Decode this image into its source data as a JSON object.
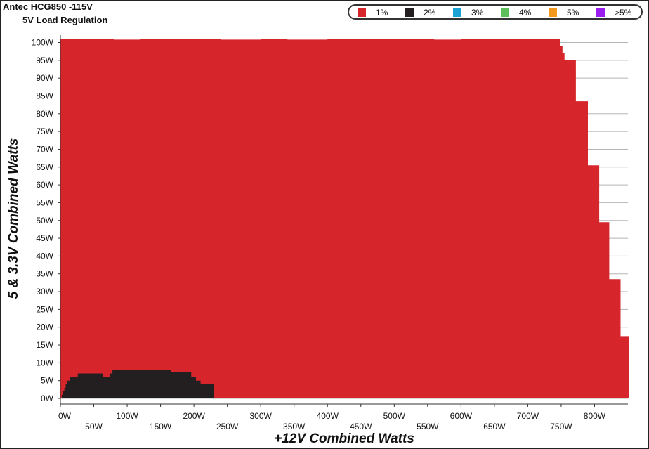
{
  "header": {
    "title": "Antec HCG850 -115V",
    "subtitle": "5V Load Regulation"
  },
  "legend": [
    {
      "label": "1%",
      "color": "#d7262b"
    },
    {
      "label": "2%",
      "color": "#231f20"
    },
    {
      "label": "3%",
      "color": "#1aa3d3"
    },
    {
      "label": "4%",
      "color": "#5cbf5c"
    },
    {
      "label": "5%",
      "color": "#f39a1e"
    },
    {
      "label": ">5%",
      "color": "#9b1df0"
    }
  ],
  "chart_data": {
    "type": "area",
    "title": "5V Load Regulation",
    "xlabel": "+12V Combined Watts",
    "ylabel": "5 & 3.3V Combined Watts",
    "xlim": [
      0,
      850
    ],
    "ylim": [
      0,
      100
    ],
    "x_ticks": [
      "0W",
      "50W",
      "100W",
      "150W",
      "200W",
      "250W",
      "300W",
      "350W",
      "400W",
      "450W",
      "500W",
      "550W",
      "600W",
      "650W",
      "700W",
      "750W",
      "800W"
    ],
    "y_ticks": [
      "0W",
      "5W",
      "10W",
      "15W",
      "20W",
      "25W",
      "30W",
      "35W",
      "40W",
      "45W",
      "50W",
      "55W",
      "60W",
      "65W",
      "70W",
      "75W",
      "80W",
      "85W",
      "90W",
      "95W",
      "100W"
    ],
    "grid": "horizontal",
    "legend_position": "top-right",
    "series": [
      {
        "name": "1%",
        "color": "#d7262b",
        "boundary": [
          [
            0,
            101
          ],
          [
            15,
            101
          ],
          [
            40,
            101
          ],
          [
            80,
            100.8
          ],
          [
            120,
            101
          ],
          [
            160,
            100.9
          ],
          [
            200,
            101
          ],
          [
            240,
            100.8
          ],
          [
            300,
            101
          ],
          [
            340,
            100.8
          ],
          [
            400,
            101
          ],
          [
            440,
            100.9
          ],
          [
            500,
            101
          ],
          [
            560,
            100.8
          ],
          [
            600,
            101
          ],
          [
            650,
            101
          ],
          [
            700,
            101
          ],
          [
            745,
            101
          ],
          [
            748,
            99
          ],
          [
            752,
            97
          ],
          [
            755,
            95
          ],
          [
            770,
            95
          ],
          [
            772,
            83.5
          ],
          [
            788,
            83.5
          ],
          [
            790,
            65.5
          ],
          [
            805,
            65.5
          ],
          [
            807,
            49.5
          ],
          [
            820,
            49.5
          ],
          [
            822,
            33.5
          ],
          [
            837,
            33.5
          ],
          [
            839,
            17.5
          ],
          [
            850,
            17.5
          ],
          [
            851,
            15
          ]
        ]
      },
      {
        "name": "2%",
        "color": "#231f20",
        "boundary": [
          [
            0,
            0
          ],
          [
            2,
            1
          ],
          [
            4,
            2
          ],
          [
            6,
            3
          ],
          [
            8,
            4
          ],
          [
            10,
            5
          ],
          [
            14,
            6
          ],
          [
            26,
            7
          ],
          [
            62,
            7
          ],
          [
            64,
            6
          ],
          [
            72,
            6
          ],
          [
            74,
            7
          ],
          [
            78,
            8
          ],
          [
            162,
            8
          ],
          [
            166,
            7.5
          ],
          [
            188,
            7.5
          ],
          [
            196,
            6
          ],
          [
            203,
            5
          ],
          [
            210,
            4
          ],
          [
            230,
            4
          ]
        ]
      }
    ]
  }
}
